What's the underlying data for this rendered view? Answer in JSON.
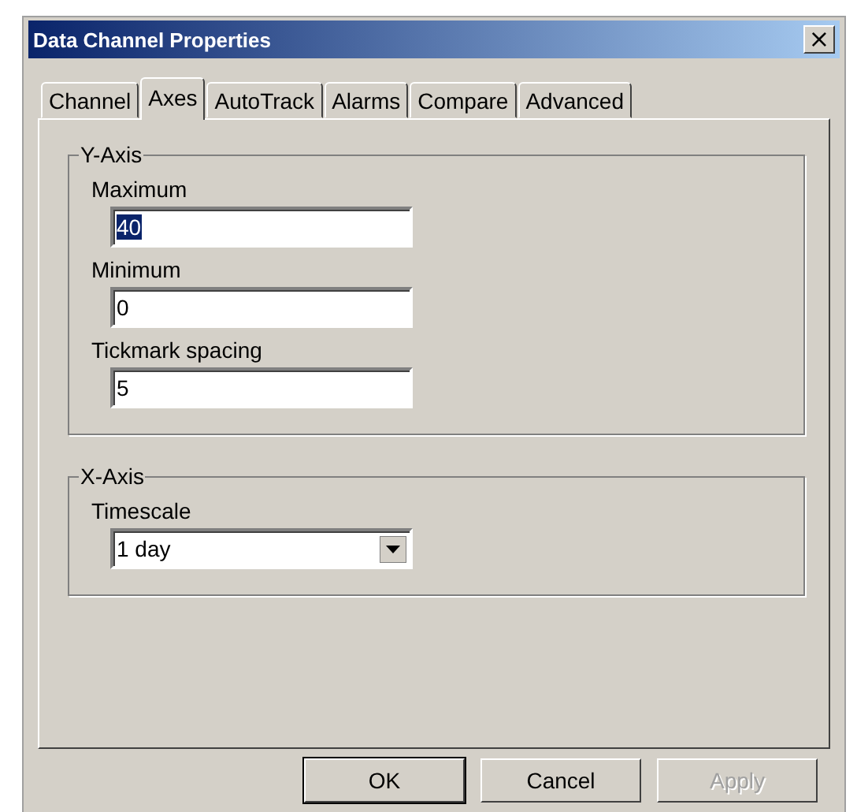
{
  "window": {
    "title": "Data Channel Properties",
    "close": "×"
  },
  "tabs": [
    {
      "label": "Channel",
      "selected": false
    },
    {
      "label": "Axes",
      "selected": true
    },
    {
      "label": "AutoTrack",
      "selected": false
    },
    {
      "label": "Alarms",
      "selected": false
    },
    {
      "label": "Compare",
      "selected": false
    },
    {
      "label": "Advanced",
      "selected": false
    }
  ],
  "groups": [
    {
      "title": "Y-Axis",
      "fields": [
        {
          "kind": "text",
          "label": "Maximum",
          "value": "40",
          "text_selected": true
        },
        {
          "kind": "text",
          "label": "Minimum",
          "value": "0",
          "text_selected": false
        },
        {
          "kind": "text",
          "label": "Tickmark spacing",
          "value": "5",
          "text_selected": false
        }
      ]
    },
    {
      "title": "X-Axis",
      "fields": [
        {
          "kind": "dropdown",
          "label": "Timescale",
          "value": "1 day"
        }
      ]
    }
  ],
  "buttons": [
    {
      "label": "OK",
      "default": true,
      "disabled": false
    },
    {
      "label": "Cancel",
      "default": false,
      "disabled": false
    },
    {
      "label": "Apply",
      "default": false,
      "disabled": true
    }
  ]
}
